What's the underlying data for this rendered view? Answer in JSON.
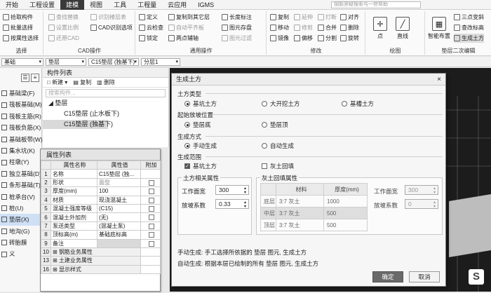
{
  "menu": {
    "items": [
      "开始",
      "工程设置",
      "建模",
      "视图",
      "工具",
      "工程量",
      "云应用",
      "IGMS"
    ],
    "active": 2,
    "search_placeholder": "钢筋答疑搜索与一些帮助"
  },
  "ribbon": {
    "select": {
      "label": "选择",
      "items": [
        "拾取构件",
        "批量选择",
        "按属性选择"
      ]
    },
    "cad": {
      "label": "CAD操作",
      "items": [
        "查找替换",
        "识别楼层表",
        "设置比例",
        "CAD识别选项",
        "还原CAD"
      ]
    },
    "general": {
      "label": "通用操作",
      "items": [
        "定义",
        "复制到其它层",
        "长度标注",
        "云检查",
        "自动平齐板",
        "图元存盘",
        "锁定",
        "两点辅轴",
        "图元过滤"
      ]
    },
    "modify": {
      "label": "修改",
      "items": [
        "复制",
        "延伸",
        "打断",
        "对齐",
        "移动",
        "修剪",
        "合并",
        "删除",
        "镜像",
        "偏移",
        "分割",
        "旋转"
      ]
    },
    "draw": {
      "label": "绘图",
      "items": [
        "点",
        "直线"
      ]
    },
    "second": {
      "label": "垫层二次编辑",
      "items": [
        "智能布置",
        "三点变斜",
        "查改标高",
        "生成土方"
      ]
    }
  },
  "toolbar2": {
    "selects": [
      "基础",
      "垫层",
      "C15垫层 (独基下)",
      "分层1"
    ]
  },
  "leftnav": {
    "items": [
      "基础梁(F)",
      "筏板基础(M)",
      "筏板主筋(R)",
      "筏板负筋(X)",
      "基础板带(W)",
      "集水坑(K)",
      "柱墩(Y)",
      "独立基础(D)",
      "条形基础(T)",
      "桩承台(V)",
      "桩(U)",
      "垫层(X)",
      "地沟(G)",
      "砖胎膜",
      "义"
    ],
    "selected": 11
  },
  "complist": {
    "title": "构件列表",
    "new": "新建",
    "copy": "复制",
    "delete": "删除",
    "search": "搜索构件...",
    "root": "垫层",
    "items": [
      "C15垫层 (止水板下)",
      "C15垫层 (独基下)"
    ],
    "selected": 1
  },
  "props": {
    "title": "属性列表",
    "headers": [
      "属性名称",
      "属性值",
      "附加"
    ],
    "rows": [
      {
        "n": "1",
        "name": "名称",
        "value": "C15垫层 (独...",
        "chk": false
      },
      {
        "n": "2",
        "name": "形状",
        "value": "面型",
        "chk": true
      },
      {
        "n": "3",
        "name": "厚度(mm)",
        "value": "100",
        "chk": true
      },
      {
        "n": "4",
        "name": "材质",
        "value": "现浇混凝土",
        "chk": true
      },
      {
        "n": "5",
        "name": "混凝土强度等级",
        "value": "(C15)",
        "chk": true
      },
      {
        "n": "6",
        "name": "混凝土外加剂",
        "value": "(无)",
        "chk": false
      },
      {
        "n": "7",
        "name": "泵送类型",
        "value": "(混凝土泵)",
        "chk": false
      },
      {
        "n": "8",
        "name": "顶标高(m)",
        "value": "基础底标高",
        "chk": true
      },
      {
        "n": "9",
        "name": "备注",
        "value": "",
        "chk": true
      },
      {
        "n": "10",
        "name": "钢筋业务属性",
        "value": "",
        "chk": false,
        "grp": true
      },
      {
        "n": "13",
        "name": "土建业务属性",
        "value": "",
        "chk": false,
        "grp": true
      },
      {
        "n": "16",
        "name": "显示样式",
        "value": "",
        "chk": false,
        "grp": true
      }
    ]
  },
  "dialog": {
    "title": "生成土方",
    "soil_type": {
      "label": "土方类型",
      "options": [
        "基坑土方",
        "大开挖土方",
        "基槽土方"
      ],
      "selected": 0
    },
    "start": {
      "label": "起始放坡位置",
      "options": [
        "垫层底",
        "垫层顶"
      ],
      "selected": 0
    },
    "method": {
      "label": "生成方式",
      "options": [
        "手动生成",
        "自动生成"
      ],
      "selected": 0
    },
    "range": {
      "label": "生成范围",
      "options": [
        "基坑土方",
        "灰土回填"
      ],
      "checked": [
        true,
        false
      ]
    },
    "soil_props": {
      "label": "土方相关属性",
      "width_label": "工作面宽",
      "width": "300",
      "slope_label": "放坡系数",
      "slope": "0.33"
    },
    "lime": {
      "label": "灰土回填属性",
      "headers": [
        "",
        "材料",
        "厚度(mm)"
      ],
      "rows": [
        [
          "底层",
          "3:7 灰土",
          "1000"
        ],
        [
          "中层",
          "3:7 灰土",
          "500"
        ],
        [
          "顶层",
          "3:7 灰土",
          "500"
        ]
      ],
      "width_label": "工作面宽",
      "width": "300",
      "slope_label": "放坡系数",
      "slope": "0"
    },
    "note_manual": "手动生成: 手工选择所依据的 垫层 图元, 生成土方",
    "note_auto": "自动生成: 根据本层已绘制的所有 垫层 图元, 生成土方",
    "ok": "确定",
    "cancel": "取消",
    "close": "×"
  }
}
